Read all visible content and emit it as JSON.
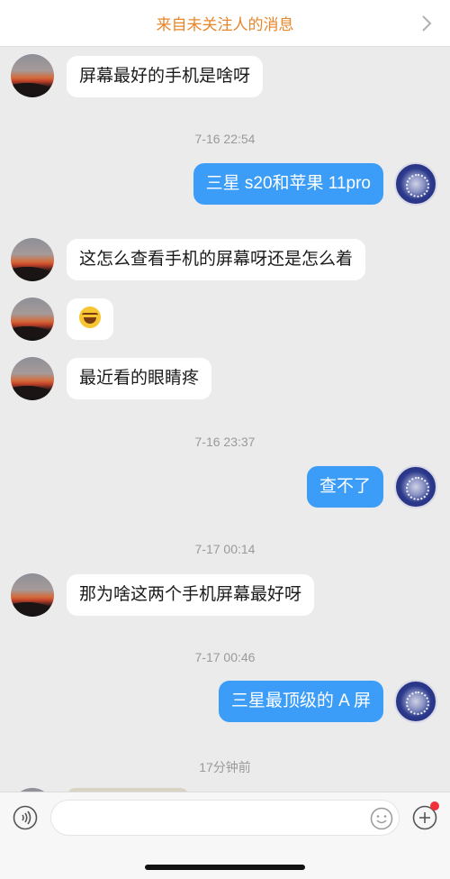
{
  "header": {
    "title": "来自未关注人的消息"
  },
  "messages": {
    "m1": "屏幕最好的手机是啥呀",
    "t1": "7-16 22:54",
    "m2": "三星 s20和苹果 11pro",
    "m3": "这怎么查看手机的屏幕呀还是怎么着",
    "m4_emoji": "laughing-with-tears-emoji",
    "m5": "最近看的眼睛疼",
    "t2": "7-16 23:37",
    "m6": "查不了",
    "t3": "7-17 00:14",
    "m7": "那为啥这两个手机屏幕最好呀",
    "t4": "7-17 00:46",
    "m8": "三星最顶级的 A 屏",
    "t5": "17分钟前"
  },
  "colors": {
    "header_text": "#e8862a",
    "sent_bubble": "#3b9df7",
    "received_bubble": "#ffffff",
    "background": "#ebebeb",
    "badge": "#f0303a"
  },
  "input": {
    "placeholder": ""
  }
}
